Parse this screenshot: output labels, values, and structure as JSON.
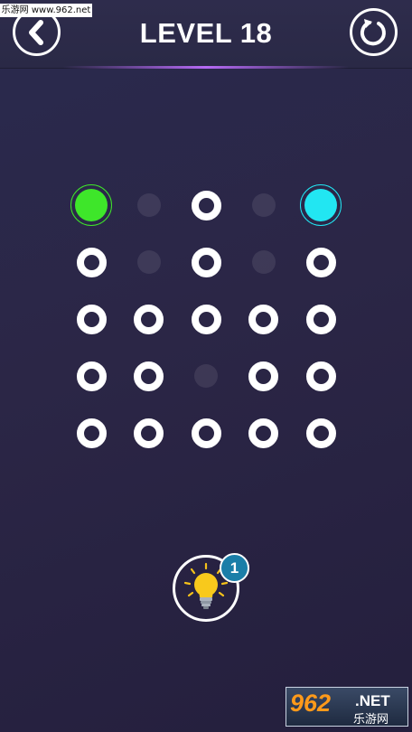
{
  "header": {
    "title": "LEVEL 18",
    "back_icon": "chevron-left-icon",
    "restart_icon": "restart-icon"
  },
  "board": {
    "rows": 5,
    "cols": 5,
    "cells": [
      [
        "endpoint-green",
        "empty",
        "ring",
        "empty",
        "endpoint-cyan"
      ],
      [
        "ring",
        "empty",
        "ring",
        "empty",
        "ring"
      ],
      [
        "ring",
        "ring",
        "ring",
        "ring",
        "ring"
      ],
      [
        "ring",
        "ring",
        "empty",
        "ring",
        "ring"
      ],
      [
        "ring",
        "ring",
        "ring",
        "ring",
        "ring"
      ]
    ],
    "colors": {
      "green": "#3ee62a",
      "cyan": "#22e6f2",
      "ring": "#ffffff"
    }
  },
  "hint": {
    "icon": "lightbulb-icon",
    "count": "1"
  },
  "watermarks": {
    "top": "乐游网 www.962.net",
    "bottom_num": "962",
    "bottom_net": ".NET",
    "bottom_cn": "乐游网"
  }
}
